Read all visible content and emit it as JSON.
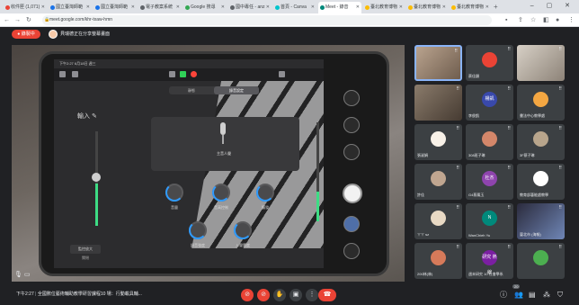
{
  "browser": {
    "tabs": [
      {
        "label": "收件匣 (1,071)",
        "color": "#ea4335"
      },
      {
        "label": "國立臺灣師範",
        "color": "#1a73e8"
      },
      {
        "label": "國立臺灣師範",
        "color": "#1a73e8"
      },
      {
        "label": "電子教案系統",
        "color": "#5f6368"
      },
      {
        "label": "Google 搜尋",
        "color": "#34a853"
      },
      {
        "label": "國中專任 - anz",
        "color": "#5f6368"
      },
      {
        "label": "首頁 - Canva",
        "color": "#00c4cc"
      },
      {
        "label": "Meet - 錄音",
        "color": "#00897b",
        "active": true
      },
      {
        "label": "臺北教育博物",
        "color": "#fbbc04"
      },
      {
        "label": "臺北教育博物",
        "color": "#fbbc04"
      },
      {
        "label": "臺北教育博物",
        "color": "#fbbc04"
      }
    ],
    "new_tab": "+",
    "url": "meet.google.com/khr-txaw-hmn",
    "window_controls": "– ▢ ✕"
  },
  "meet": {
    "recording_label": "錄製中",
    "presenter_label": "貝瑞德正在分享螢幕畫面",
    "time": "下午2:27",
    "meeting_title": "全國數位藝術輔助教學研習課程10 場：行動載具輔...",
    "participant_count": "20"
  },
  "app_screen": {
    "status_time": "下午2:27  6月18日 週三",
    "mode_tabs": [
      "靜態",
      "錄音設定"
    ],
    "input_label": "輸入",
    "mic_label": "主音人聲",
    "knobs": [
      "音量",
      "音高控制",
      "觸發",
      "錄音強度",
      "入聲響度"
    ],
    "monitor_button": "監控放大",
    "monitor_sub": "關閉",
    "input_level": 0.45,
    "output_level": 0.3
  },
  "participants": [
    {
      "name": "",
      "initials": "",
      "color": "#c97a6a",
      "video": "video",
      "active": true
    },
    {
      "name": "蔡佳穎",
      "initials": "",
      "color": "#ea4335",
      "video": ""
    },
    {
      "name": "",
      "initials": "",
      "color": "#8d8378",
      "video": "video2"
    },
    {
      "name": "",
      "initials": "",
      "color": "#a08070",
      "video": "video3"
    },
    {
      "name": "李俊凱",
      "initials": "楊凱",
      "color": "#3949ab",
      "video": ""
    },
    {
      "name": "書法中心教學處",
      "initials": "",
      "color": "#f4a742",
      "video": ""
    },
    {
      "name": "張淑娟",
      "initials": "",
      "color": "#f8f1e8",
      "video": ""
    },
    {
      "name": "308班子琳",
      "initials": "",
      "color": "#d4876a",
      "video": ""
    },
    {
      "name": "3F蔡子琳",
      "initials": "",
      "color": "#b8a58c",
      "video": ""
    },
    {
      "name": "許佳",
      "initials": "",
      "color": "#c0a690",
      "video": ""
    },
    {
      "name": "G4蔡鳳玉",
      "initials": "杜杰",
      "color": "#8e44ad",
      "video": ""
    },
    {
      "name": "教育部藝能處教學",
      "initials": "",
      "color": "#ffffff",
      "video": ""
    },
    {
      "name": "ㄚㄚ sz",
      "initials": "",
      "color": "#e8d9c4",
      "video": ""
    },
    {
      "name": "WanChieh Yu",
      "initials": "N",
      "color": "#00897b",
      "video": ""
    },
    {
      "name": "臺北市 (海報)",
      "initials": "",
      "color": "#4f6fa8",
      "video": "video4"
    },
    {
      "name": "200林(林)",
      "initials": "",
      "color": "#d67a5a",
      "video": ""
    },
    {
      "name": "週末研究 10 社會學系",
      "initials": "研究 熱線",
      "color": "#7b1fa2",
      "video": ""
    },
    {
      "name": "",
      "initials": "",
      "color": "#4caf50",
      "video": ""
    }
  ]
}
